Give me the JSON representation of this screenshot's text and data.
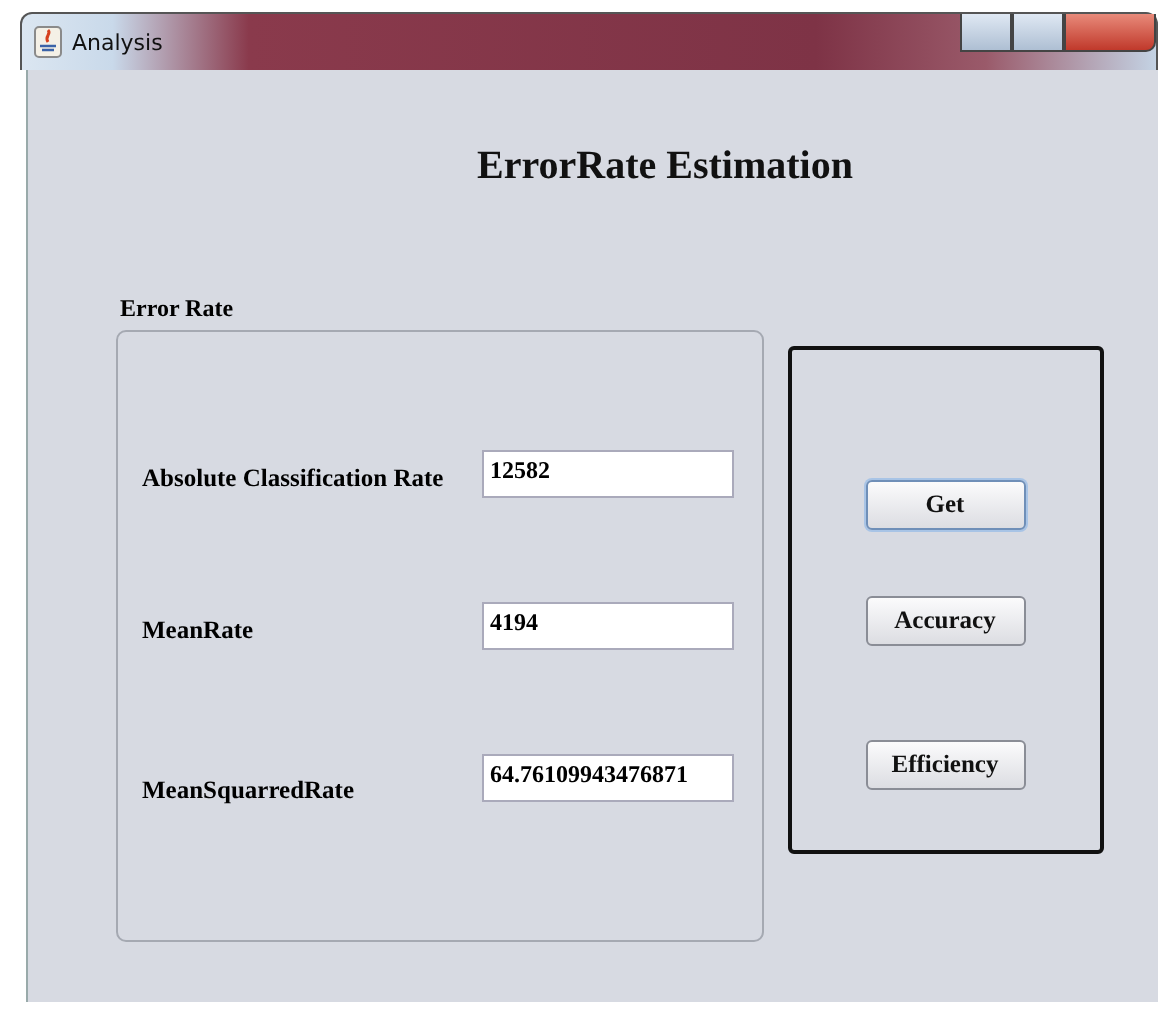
{
  "window": {
    "title": "Analysis"
  },
  "heading": "ErrorRate Estimation",
  "group": {
    "title": "Error Rate",
    "fields": [
      {
        "label": "Absolute Classification Rate",
        "value": "12582"
      },
      {
        "label": "MeanRate",
        "value": "4194"
      },
      {
        "label": "MeanSquarredRate",
        "value": "64.76109943476871"
      }
    ]
  },
  "buttons": [
    {
      "label": "Get",
      "focused": true
    },
    {
      "label": "Accuracy",
      "focused": false
    },
    {
      "label": "Efficiency",
      "focused": false
    }
  ]
}
